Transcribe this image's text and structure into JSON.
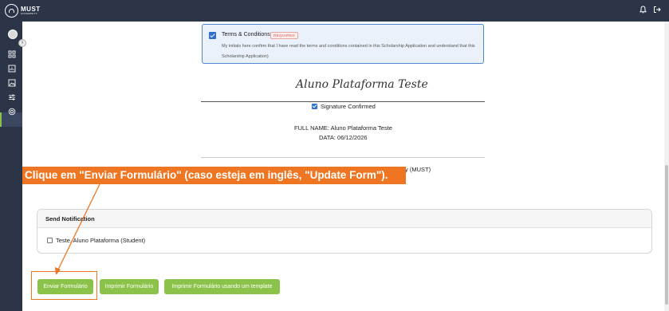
{
  "app": {
    "logo_main": "MUST",
    "logo_sub": "UNIVERSITY",
    "icons": [
      "bell-icon",
      "logout-icon"
    ]
  },
  "sidebar": {
    "icons": [
      "dashboard-icon",
      "chart-icon",
      "image-icon",
      "settings-sliders-icon",
      "support-icon"
    ]
  },
  "terms": {
    "title": "Terms & Conditions",
    "badge": "REQUIRED",
    "text": "My initials here confirm that I have read the terms and conditions contained in this Scholarship Application and understand that this Scholarship Application)"
  },
  "signature": {
    "name": "Aluno Plataforma Teste",
    "confirmed_label": "Signature Confirmed",
    "full_name": "FULL NAME: Aluno Plataforma Teste",
    "date": "DATA: 06/12/2026",
    "partial_text": "y (MUST)"
  },
  "annotation": {
    "banner": "Clique em \"Enviar Formulário\" (caso esteja em inglês, \"Update Form\")."
  },
  "notification": {
    "title": "Send Notification",
    "recipient": "Teste, Aluno Plataforma (Student)"
  },
  "actions": {
    "send": "Enviar Formulário",
    "print": "Imprimir Formulário",
    "print_template": "Imprimir Formulário usando um template"
  },
  "colors": {
    "topbar": "#2c3548",
    "accent_green": "#8bc34a",
    "annotation_orange": "#ee7622",
    "checkbox_blue": "#2f6fd0"
  }
}
